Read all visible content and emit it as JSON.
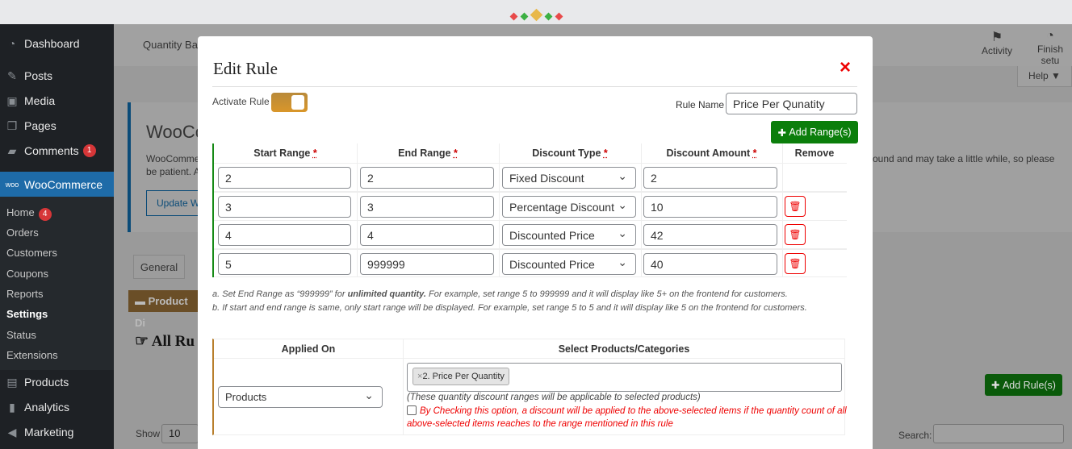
{
  "loader": {
    "colors": [
      "#e84a4a",
      "#3cb043",
      "#e8b84a",
      "#3cb043",
      "#e84a4a"
    ]
  },
  "sidebar": {
    "items": [
      {
        "label": "Dashboard",
        "icon": "dashboard-icon"
      },
      {
        "label": "Posts",
        "icon": "pin-icon"
      },
      {
        "label": "Media",
        "icon": "media-icon"
      },
      {
        "label": "Pages",
        "icon": "pages-icon"
      },
      {
        "label": "Comments",
        "icon": "comment-icon",
        "badge": "1"
      },
      {
        "label": "WooCommerce",
        "icon": "woo-icon"
      }
    ],
    "submenu": [
      {
        "label": "Home",
        "badge": "4"
      },
      {
        "label": "Orders"
      },
      {
        "label": "Customers"
      },
      {
        "label": "Coupons"
      },
      {
        "label": "Reports"
      },
      {
        "label": "Settings"
      },
      {
        "label": "Status"
      },
      {
        "label": "Extensions"
      }
    ],
    "bottom": [
      {
        "label": "Products"
      },
      {
        "label": "Analytics"
      },
      {
        "label": "Marketing"
      }
    ]
  },
  "header": {
    "title": "Quantity Ba",
    "activity": "Activity",
    "finish": "Finish setu",
    "help": "Help ▼"
  },
  "background": {
    "notice_title": "WooCo",
    "notice_text1": "WooComme",
    "notice_text2": "be patient. A",
    "notice_right": "ound and may take a little while, so please",
    "update_btn": "Update W",
    "tab_general": "General",
    "product_bar": "Product Di",
    "all_rules": "All Ru",
    "show": "Show",
    "show_value": "10",
    "add_rules": "Add Rule(s)",
    "search": "Search:"
  },
  "modal": {
    "title": "Edit Rule",
    "close": "×",
    "activate_label": "Activate Rule",
    "activate_on": true,
    "rule_name_label": "Rule Name",
    "rule_name_value": "Price Per Qunatity",
    "add_range": "Add Range(s)",
    "columns": [
      "Start Range",
      "End Range",
      "Discount Type",
      "Discount Amount",
      "Remove"
    ],
    "rows": [
      {
        "start": "2",
        "end": "2",
        "type": "Fixed Discount",
        "amount": "2",
        "removable": false
      },
      {
        "start": "3",
        "end": "3",
        "type": "Percentage Discount",
        "amount": "10",
        "removable": true
      },
      {
        "start": "4",
        "end": "4",
        "type": "Discounted Price",
        "amount": "42",
        "removable": true
      },
      {
        "start": "5",
        "end": "999999",
        "type": "Discounted Price",
        "amount": "40",
        "removable": true
      }
    ],
    "note_a_1": "a. Set End Range as “999999” for ",
    "note_a_bold": "unlimited quantity.",
    "note_a_2": " For example, set range 5 to 999999 and it will display like 5+ on the frontend for customers.",
    "note_b": "b. If start and end range is same, only start range will be displayed. For example, set range 5 to 5 and it will display like 5 on the frontend for customers.",
    "applied_on_header": "Applied On",
    "select_header": "Select Products/Categories",
    "applied_on_value": "Products",
    "selected_tag": "2. Price Per Quantity",
    "helper": "(These quantity discount ranges will be applicable to selected products)",
    "checkbox_text": "By Checking this option, a discount will be applied to the above-selected items if the quantity count of all above-selected items reaches to the range mentioned in this rule"
  }
}
